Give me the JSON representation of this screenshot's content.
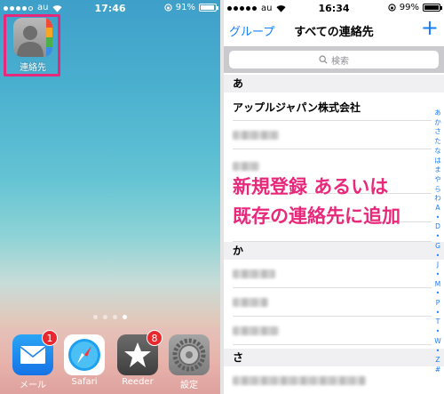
{
  "left": {
    "status": {
      "carrier": "au",
      "time": "17:46",
      "battery": "91%",
      "battery_level": 0.91
    },
    "highlight_color": "#e8287a",
    "highlighted_app": {
      "label": "連絡先",
      "icon": "contacts-icon"
    },
    "page_dots": [
      false,
      false,
      false,
      true
    ],
    "dock": [
      {
        "label": "メール",
        "icon": "mail-icon",
        "badge": "1"
      },
      {
        "label": "Safari",
        "icon": "compass-icon",
        "badge": ""
      },
      {
        "label": "Reeder",
        "icon": "star-icon",
        "badge": "8"
      },
      {
        "label": "設定",
        "icon": "gear-icon",
        "badge": ""
      }
    ]
  },
  "right": {
    "status": {
      "carrier": "au",
      "time": "16:34",
      "battery": "99%",
      "battery_level": 0.99
    },
    "nav": {
      "left": "グループ",
      "title": "すべての連絡先",
      "add": "+"
    },
    "search": {
      "placeholder": "検索"
    },
    "sections": [
      {
        "header": "あ"
      },
      {
        "header": "か"
      },
      {
        "header": "さ"
      }
    ],
    "first_contact": "アップルジャパン株式会社",
    "overlay_line1": "新規登録 あるいは",
    "overlay_line2": "既存の連絡先に追加",
    "index": [
      "あ",
      "か",
      "さ",
      "た",
      "な",
      "は",
      "ま",
      "や",
      "ら",
      "わ",
      "A",
      "•",
      "D",
      "•",
      "G",
      "•",
      "J",
      "•",
      "M",
      "•",
      "P",
      "•",
      "T",
      "•",
      "W",
      "•",
      "Z",
      "#"
    ]
  },
  "colors": {
    "accent": "#147efb",
    "highlight": "#e8287a",
    "badge": "#e8282e"
  }
}
